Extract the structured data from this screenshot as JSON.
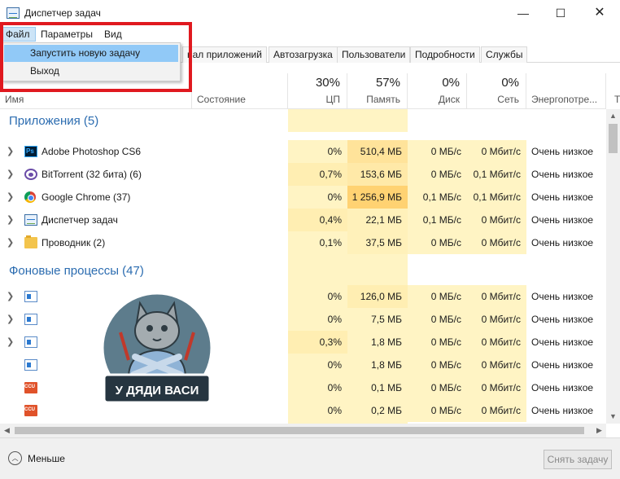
{
  "window": {
    "title": "Диспетчер задач",
    "controls": {
      "minimize": "—",
      "maximize": "☐",
      "close": "✕"
    }
  },
  "menubar": {
    "file": "Файл",
    "params": "Параметры",
    "view": "Вид",
    "file_menu": [
      "Запустить новую задачу",
      "Выход"
    ]
  },
  "tabs": [
    "нал приложений",
    "Автозагрузка",
    "Пользователи",
    "Подробности",
    "Службы"
  ],
  "columns": {
    "name": "Имя",
    "status": "Состояние",
    "cpu": {
      "pct": "30%",
      "label": "ЦП"
    },
    "memory": {
      "pct": "57%",
      "label": "Память"
    },
    "disk": {
      "pct": "0%",
      "label": "Диск"
    },
    "network": {
      "pct": "0%",
      "label": "Сеть"
    },
    "power": "Энергопотре...",
    "cut": "Т"
  },
  "groups": {
    "apps": "Приложения (5)",
    "background": "Фоновые процессы (47)"
  },
  "apps": [
    {
      "icon": "photoshop-icon",
      "name": "Adobe Photoshop CS6",
      "cpu": "0%",
      "mem": "510,4 МБ",
      "disk": "0 МБ/с",
      "net": "0 Мбит/с",
      "power": "Очень низкое"
    },
    {
      "icon": "bittorrent-icon",
      "name": "BitTorrent (32 бита) (6)",
      "cpu": "0,7%",
      "mem": "153,6 МБ",
      "disk": "0 МБ/с",
      "net": "0,1 Мбит/с",
      "power": "Очень низкое"
    },
    {
      "icon": "chrome-icon",
      "name": "Google Chrome (37)",
      "cpu": "0%",
      "mem": "1 256,9 МБ",
      "disk": "0,1 МБ/с",
      "net": "0,1 Мбит/с",
      "power": "Очень низкое"
    },
    {
      "icon": "task-manager-icon",
      "name": "Диспетчер задач",
      "cpu": "0,4%",
      "mem": "22,1 МБ",
      "disk": "0,1 МБ/с",
      "net": "0 Мбит/с",
      "power": "Очень низкое"
    },
    {
      "icon": "folder-icon",
      "name": "Проводник (2)",
      "cpu": "0,1%",
      "mem": "37,5 МБ",
      "disk": "0 МБ/с",
      "net": "0 Мбит/с",
      "power": "Очень низкое"
    }
  ],
  "background": [
    {
      "icon": "window-icon",
      "cpu": "0%",
      "mem": "126,0 МБ",
      "disk": "0 МБ/с",
      "net": "0 Мбит/с",
      "power": "Очень низкое"
    },
    {
      "icon": "window-icon",
      "cpu": "0%",
      "mem": "7,5 МБ",
      "disk": "0 МБ/с",
      "net": "0 Мбит/с",
      "power": "Очень низкое"
    },
    {
      "icon": "window-icon",
      "cpu": "0,3%",
      "mem": "1,8 МБ",
      "disk": "0 МБ/с",
      "net": "0 Мбит/с",
      "power": "Очень низкое"
    },
    {
      "icon": "window-icon",
      "cpu": "0%",
      "mem": "1,8 МБ",
      "disk": "0 МБ/с",
      "net": "0 Мбит/с",
      "power": "Очень низкое"
    },
    {
      "icon": "ccu-icon",
      "cpu": "0%",
      "mem": "0,1 МБ",
      "disk": "0 МБ/с",
      "net": "0 Мбит/с",
      "power": "Очень низкое"
    },
    {
      "icon": "ccu-icon",
      "cpu": "0%",
      "mem": "0,2 МБ",
      "disk": "0 МБ/с",
      "net": "0 Мбит/с",
      "power": "Очень низкое"
    }
  ],
  "footer": {
    "less": "Меньше",
    "end_task": "Снять задачу"
  },
  "watermark": "У ДЯДИ ВАСИ",
  "colors": {
    "group_title": "#2b6cb0",
    "heat_light": "#fff4c4",
    "heat_medium": "#ffe9a8",
    "heat_strong": "#ffd272",
    "highlight_frame": "#e0191f",
    "menu_highlight": "#91c9f7"
  }
}
